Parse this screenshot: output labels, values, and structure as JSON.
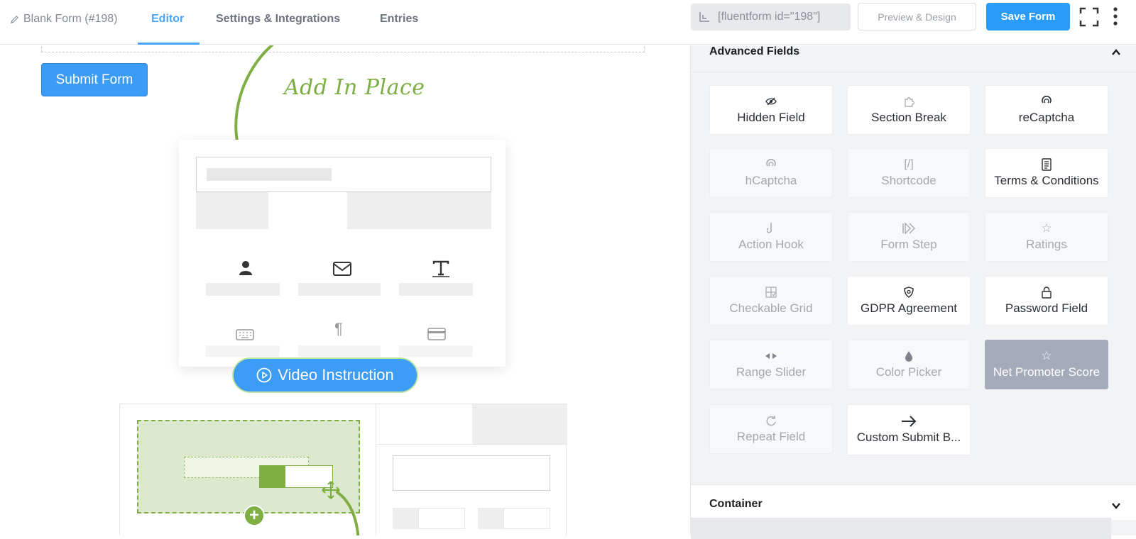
{
  "header": {
    "form_title": "Blank Form (#198)",
    "tabs": [
      {
        "label": "Editor",
        "active": true
      },
      {
        "label": "Settings & Integrations",
        "active": false
      },
      {
        "label": "Entries",
        "active": false
      }
    ],
    "shortcode": "[fluentform id=\"198\"]",
    "preview_label": "Preview & Design",
    "save_label": "Save Form"
  },
  "editor": {
    "submit_label": "Submit Form",
    "add_in_place": "Add In Place",
    "video_label": "Video Instruction"
  },
  "panel": {
    "advanced_title": "Advanced Fields",
    "fields": [
      {
        "label": "Hidden Field",
        "icon": "eye-slash-icon",
        "state": "enabled"
      },
      {
        "label": "Section Break",
        "icon": "puzzle-icon",
        "state": "enabled"
      },
      {
        "label": "reCaptcha",
        "icon": "recaptcha-icon",
        "state": "enabled"
      },
      {
        "label": "hCaptcha",
        "icon": "hcaptcha-icon",
        "state": "disabled"
      },
      {
        "label": "Shortcode",
        "icon": "shortcode-icon",
        "glyph": "[/]",
        "state": "disabled"
      },
      {
        "label": "Terms & Conditions",
        "icon": "scroll-icon",
        "state": "enabled"
      },
      {
        "label": "Action Hook",
        "icon": "hook-icon",
        "state": "disabled"
      },
      {
        "label": "Form Step",
        "icon": "form-step-icon",
        "state": "disabled"
      },
      {
        "label": "Ratings",
        "icon": "star-icon",
        "state": "disabled"
      },
      {
        "label": "Checkable Grid",
        "icon": "grid-icon",
        "state": "disabled"
      },
      {
        "label": "GDPR Agreement",
        "icon": "shield-icon",
        "state": "enabled"
      },
      {
        "label": "Password Field",
        "icon": "lock-icon",
        "state": "enabled"
      },
      {
        "label": "Range Slider",
        "icon": "range-icon",
        "state": "disabled"
      },
      {
        "label": "Color Picker",
        "icon": "drop-icon",
        "state": "disabled"
      },
      {
        "label": "Net Promoter Score",
        "icon": "star-icon",
        "state": "selected"
      },
      {
        "label": "Repeat Field",
        "icon": "repeat-icon",
        "state": "disabled"
      },
      {
        "label": "Custom Submit B...",
        "icon": "arrow-right-icon",
        "state": "enabled"
      }
    ],
    "container_title": "Container"
  }
}
